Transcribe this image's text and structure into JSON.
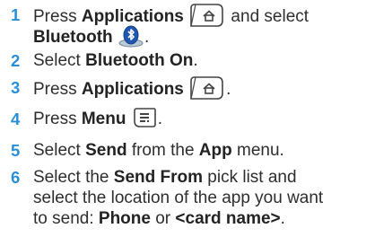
{
  "steps": [
    {
      "number": "1",
      "line1": {
        "t0": "Press ",
        "b0": "Applications",
        "t1": " and select"
      },
      "line2": {
        "b0": "Bluetooth",
        "t0": "."
      },
      "icons": [
        "applications-key-icon",
        "bluetooth-app-icon"
      ]
    },
    {
      "number": "2",
      "t0": "Select ",
      "b0": "Bluetooth On",
      "t1": "."
    },
    {
      "number": "3",
      "t0": "Press ",
      "b0": "Applications",
      "t1": ".",
      "icons": [
        "applications-key-icon"
      ]
    },
    {
      "number": "4",
      "t0": "Press ",
      "b0": "Menu",
      "t1": ".",
      "icons": [
        "menu-key-icon"
      ]
    },
    {
      "number": "5",
      "t0": "Select ",
      "b0": "Send",
      "t1": " from the ",
      "b1": "App",
      "t2": " menu."
    },
    {
      "number": "6",
      "line1": {
        "t0": "Select the ",
        "b0": "Send From",
        "t1": " pick list and"
      },
      "line2": {
        "t0": "select the location of the app you want"
      },
      "line3": {
        "t0": "to send: ",
        "b0": "Phone",
        "t1": " or ",
        "b1": "<card name>",
        "t2": "."
      }
    }
  ],
  "colors": {
    "step_number": "#2a8fd4",
    "text": "#2e2e2e"
  }
}
